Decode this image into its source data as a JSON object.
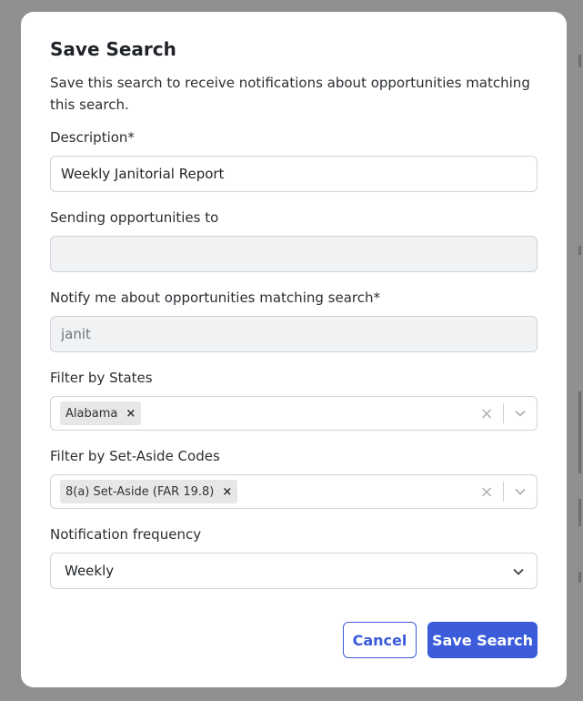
{
  "modal": {
    "title": "Save Search",
    "description": "Save this search to receive notifications about opportunities matching this search."
  },
  "fields": {
    "description": {
      "label": "Description*",
      "value": "Weekly Janitorial Report"
    },
    "sending_to": {
      "label": "Sending opportunities to",
      "value": ""
    },
    "notify": {
      "label": "Notify me about opportunities matching search*",
      "value": "janit"
    },
    "states": {
      "label": "Filter by States",
      "chips": [
        "Alabama"
      ]
    },
    "set_aside": {
      "label": "Filter by Set-Aside Codes",
      "chips": [
        "8(a) Set-Aside (FAR 19.8)"
      ]
    },
    "frequency": {
      "label": "Notification frequency",
      "value": "Weekly"
    }
  },
  "buttons": {
    "cancel": "Cancel",
    "save": "Save Search"
  },
  "icons": {
    "chip_remove": "close-icon",
    "clear": "clear-icon",
    "dropdown": "chevron-down-icon"
  },
  "colors": {
    "primary": "#3b5bdb",
    "overlay": "#8f8f8f"
  }
}
